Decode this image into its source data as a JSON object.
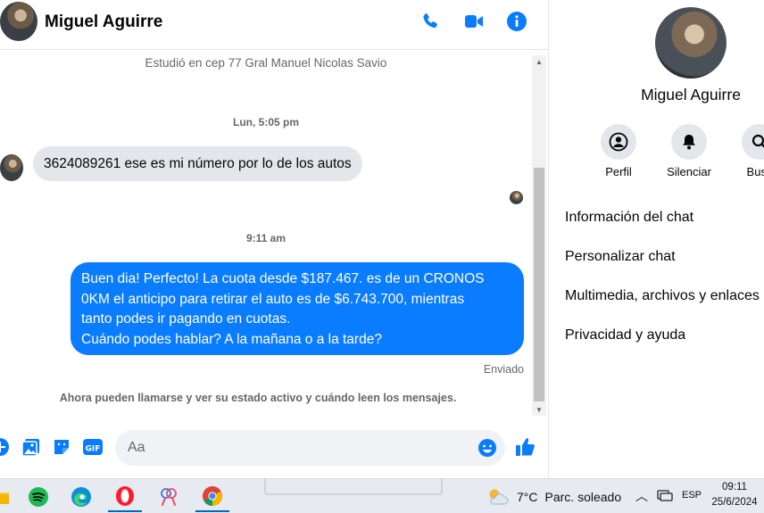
{
  "chat": {
    "contact_name": "Miguel Aguirre",
    "bio_line": "Estudió en cep 77 Gral Manuel Nicolas Savio",
    "timestamp_1": "Lun, 5:05 pm",
    "incoming_message": "3624089261 ese es mi número por lo de los autos",
    "timestamp_2": "9:11 am",
    "outgoing_message_lines": [
      "Buen dia! Perfecto! La cuota desde $187.467. es de un CRONOS",
      "0KM el anticipo para retirar el auto es de $6.743.700, mientras",
      "tanto podes ir pagando en cuotas.",
      "Cuándo podes hablar? A la mañana o a la tarde?"
    ],
    "status": "Enviado",
    "notice": "Ahora pueden llamarse y ver su estado activo y cuándo leen los mensajes.",
    "input_placeholder": "Aa",
    "accent_color": "#0a7cff"
  },
  "info_panel": {
    "name": "Miguel Aguirre",
    "actions": [
      {
        "label": "Perfil",
        "icon": "profile-icon"
      },
      {
        "label": "Silenciar",
        "icon": "bell-icon"
      },
      {
        "label": "Busc",
        "icon": "search-icon"
      }
    ],
    "menu": [
      "Información del chat",
      "Personalizar chat",
      "Multimedia, archivos y enlaces",
      "Privacidad y ayuda"
    ]
  },
  "taskbar": {
    "weather_temp": "7°C",
    "weather_desc": "Parc. soleado",
    "language": "ESP",
    "time": "09:11",
    "date": "25/6/2024"
  }
}
